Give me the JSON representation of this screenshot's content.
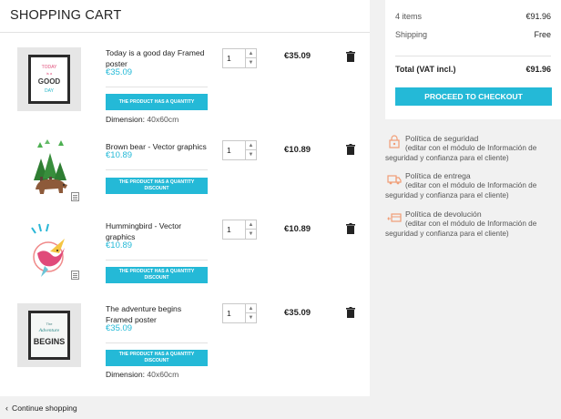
{
  "cart": {
    "title": "SHOPPING CART",
    "items": [
      {
        "name": "Today is a good day Framed poster",
        "price": "€35.09",
        "discount_label": "THE PRODUCT HAS A QUANTITY DISCOUNT",
        "dimension_label": "Dimension:",
        "dimension_value": "40x60cm",
        "quantity": "1",
        "total": "€35.09"
      },
      {
        "name": "Brown bear - Vector graphics",
        "price": "€10.89",
        "discount_label": "THE PRODUCT HAS A QUANTITY DISCOUNT",
        "quantity": "1",
        "total": "€10.89"
      },
      {
        "name": "Hummingbird - Vector graphics",
        "price": "€10.89",
        "discount_label": "THE PRODUCT HAS A QUANTITY DISCOUNT",
        "quantity": "1",
        "total": "€10.89"
      },
      {
        "name": "The adventure begins Framed poster",
        "price": "€35.09",
        "discount_label": "THE PRODUCT HAS A QUANTITY DISCOUNT",
        "dimension_label": "Dimension:",
        "dimension_value": "40x60cm",
        "quantity": "1",
        "total": "€35.09"
      }
    ],
    "continue_label": "Continue shopping"
  },
  "summary": {
    "items_label": "4 items",
    "items_value": "€91.96",
    "shipping_label": "Shipping",
    "shipping_value": "Free",
    "total_label": "Total (VAT incl.)",
    "total_value": "€91.96",
    "checkout_label": "PROCEED TO CHECKOUT"
  },
  "reassurance": [
    {
      "icon": "security-lock-icon",
      "title": "Política de seguridad",
      "description": "(editar con el módulo de Información de seguridad y confianza para el cliente)"
    },
    {
      "icon": "delivery-truck-icon",
      "title": "Política de entrega",
      "description": "(editar con el módulo de Información de seguridad y confianza para el cliente)"
    },
    {
      "icon": "return-package-icon",
      "title": "Política de devolución",
      "description": "(editar con el módulo de Información de seguridad y confianza para el cliente)"
    }
  ],
  "colors": {
    "accent": "#24b9d7",
    "icon_orange": "#f19d76",
    "background": "#f1f1f1"
  }
}
